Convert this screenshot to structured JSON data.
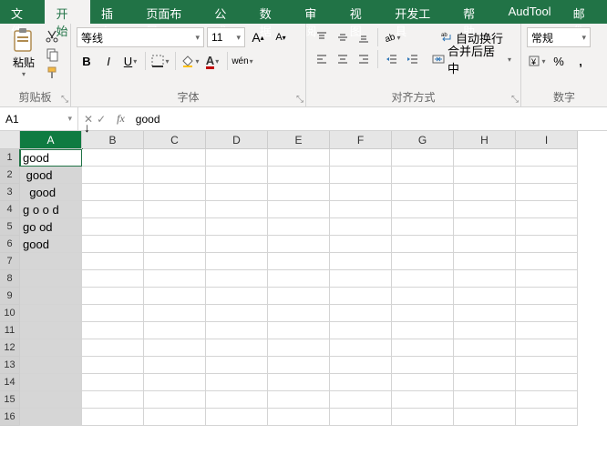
{
  "tabs": [
    "文件",
    "开始",
    "插入",
    "页面布局",
    "公式",
    "数据",
    "审阅",
    "视图",
    "开发工具",
    "帮助",
    "AudTool",
    "邮件"
  ],
  "activeTab": 1,
  "ribbon": {
    "clipboard": {
      "paste": "粘贴",
      "label": "剪贴板"
    },
    "font": {
      "name": "等线",
      "size": "11",
      "label": "字体",
      "ruby": "wén"
    },
    "align": {
      "wrap": "自动换行",
      "merge": "合并后居中",
      "label": "对齐方式"
    },
    "number": {
      "format": "常规",
      "label": "数字",
      "percent": "%"
    }
  },
  "namebox": "A1",
  "formula": "good",
  "cols": [
    "A",
    "B",
    "C",
    "D",
    "E",
    "F",
    "G",
    "H",
    "I"
  ],
  "selectedCol": 0,
  "cells": {
    "A1": "good",
    "A2": " good",
    "A3": "  good",
    "A4": "g o o d",
    "A5": "go od",
    "A6": "good"
  },
  "rowCount": 16
}
